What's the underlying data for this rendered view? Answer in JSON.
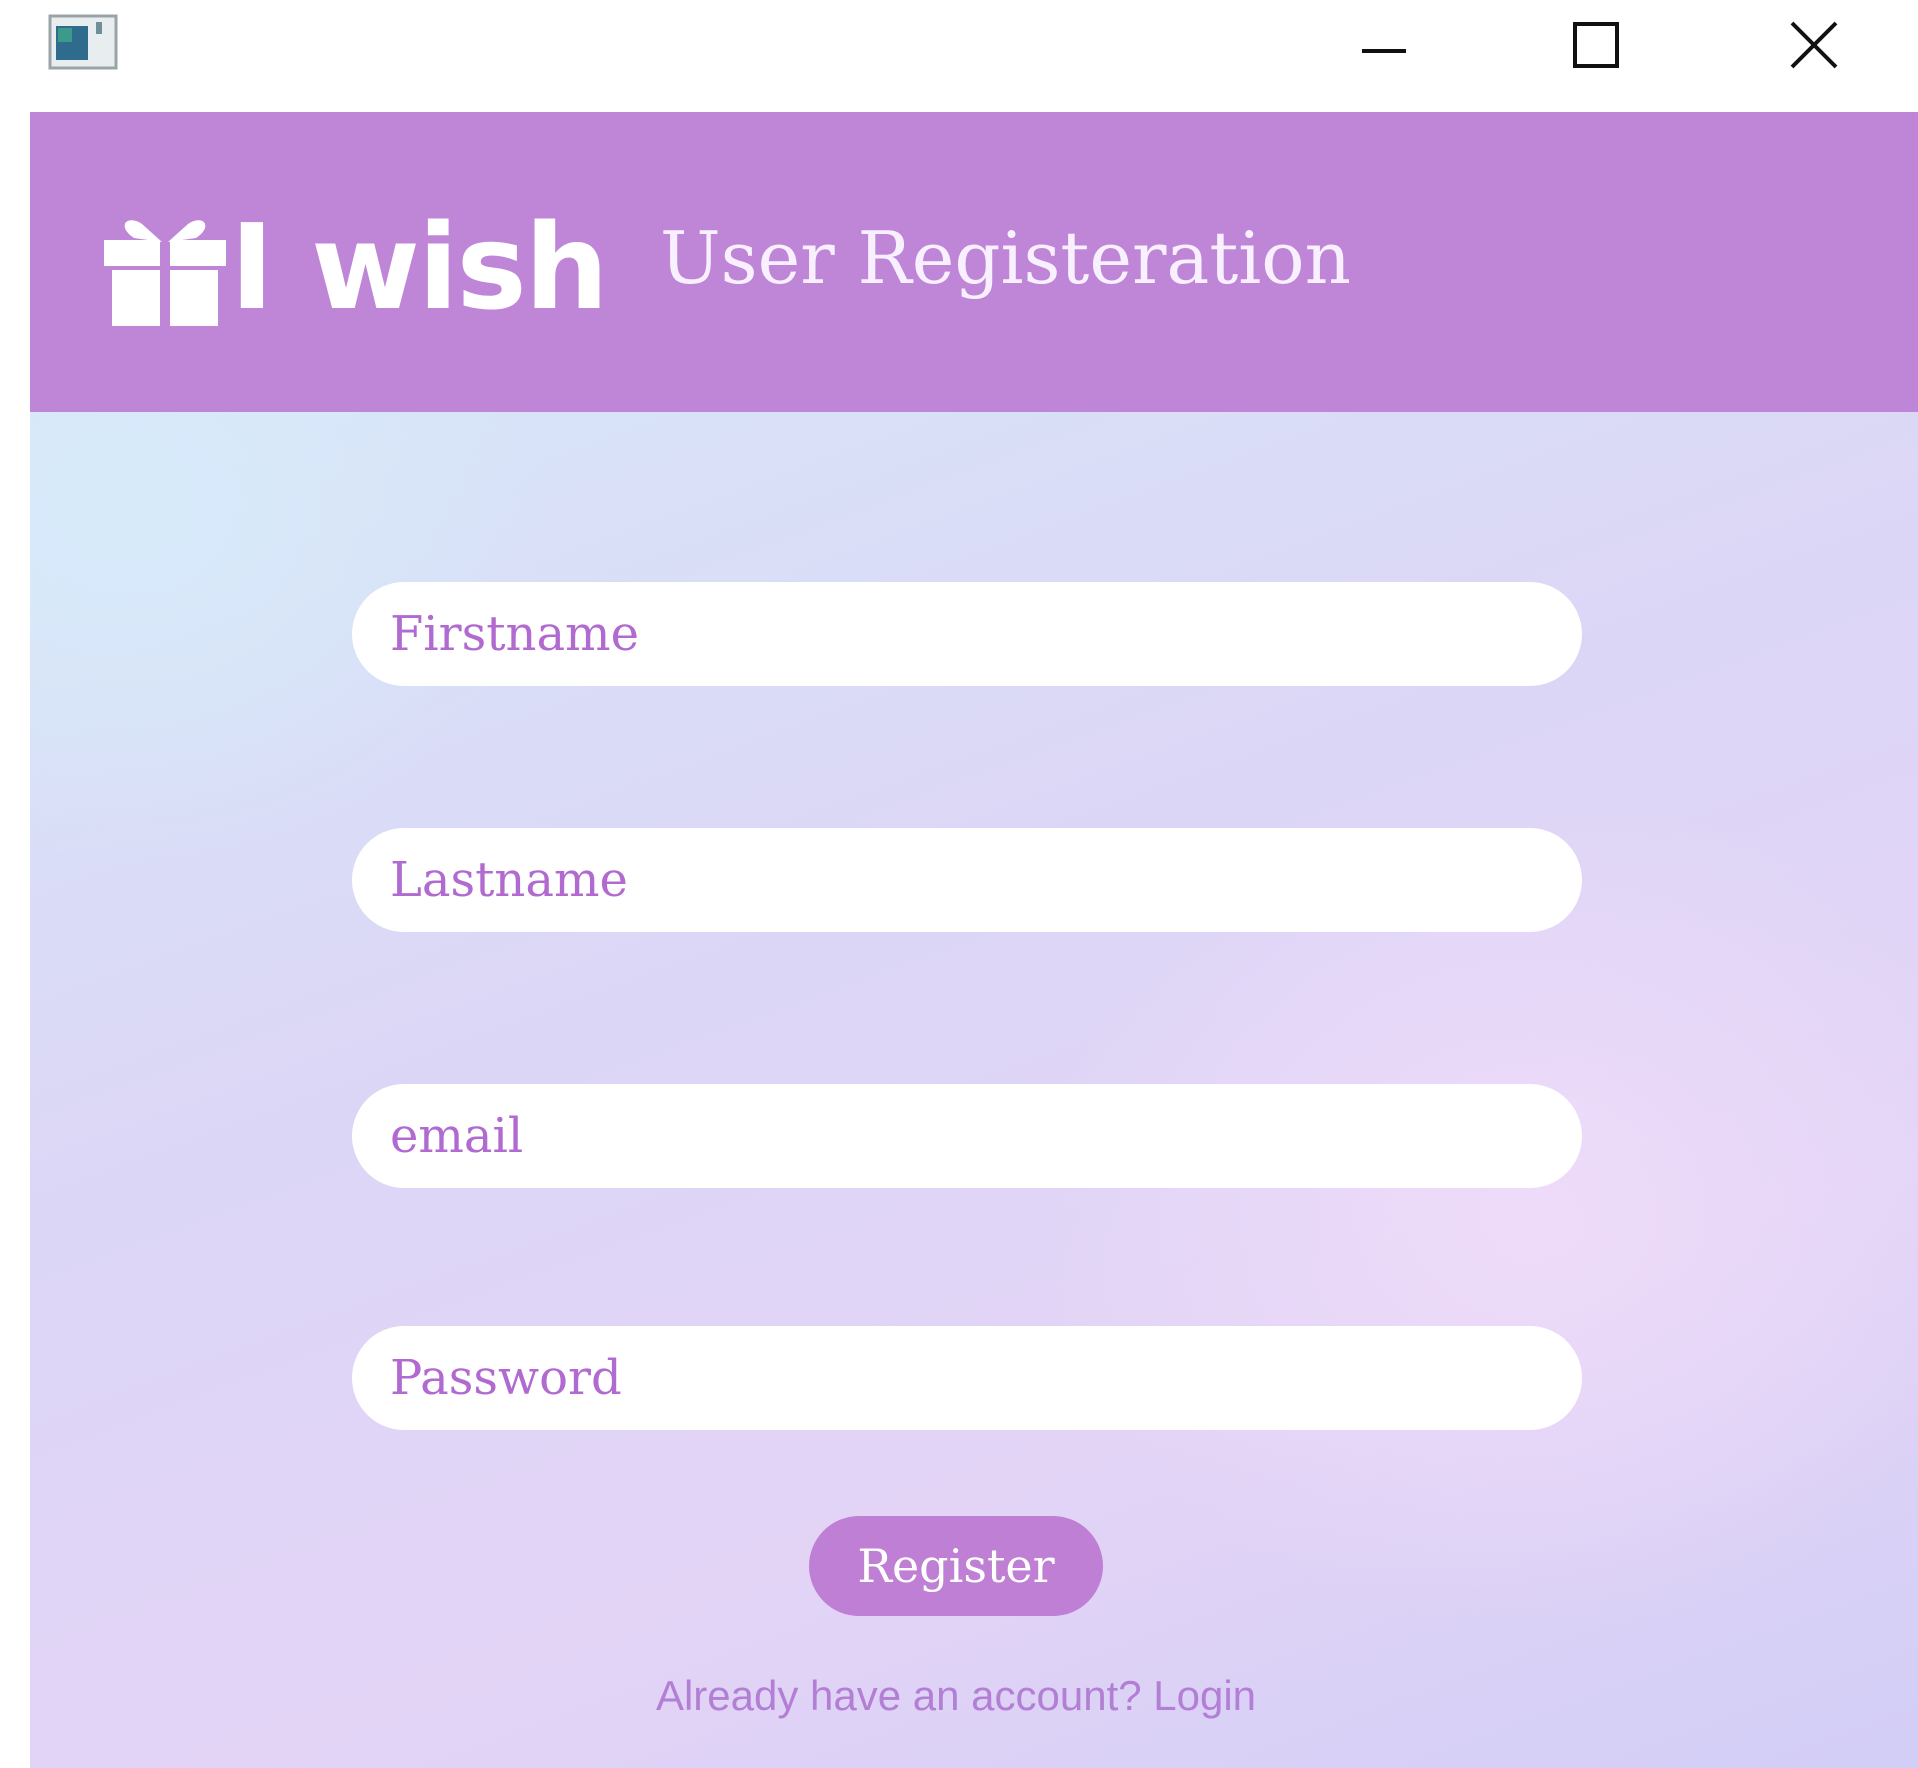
{
  "titlebar": {
    "icons": {
      "app": "app-window-icon",
      "minimize": "minimize-icon",
      "maximize": "maximize-icon",
      "close": "close-icon"
    }
  },
  "header": {
    "logo_text": "I wish",
    "logo_icon": "gift-icon",
    "title": "User Registeration"
  },
  "form": {
    "firstname": {
      "placeholder": "Firstname",
      "value": ""
    },
    "lastname": {
      "placeholder": "Lastname",
      "value": ""
    },
    "email": {
      "placeholder": "email",
      "value": ""
    },
    "password": {
      "placeholder": "Password",
      "value": ""
    },
    "register_label": "Register",
    "login_prompt": "Already have an account? Login"
  },
  "colors": {
    "header_bg": "#bf86d8",
    "button_bg": "#bf7fd4",
    "placeholder": "#b06ad0",
    "link": "#b27fd4"
  }
}
